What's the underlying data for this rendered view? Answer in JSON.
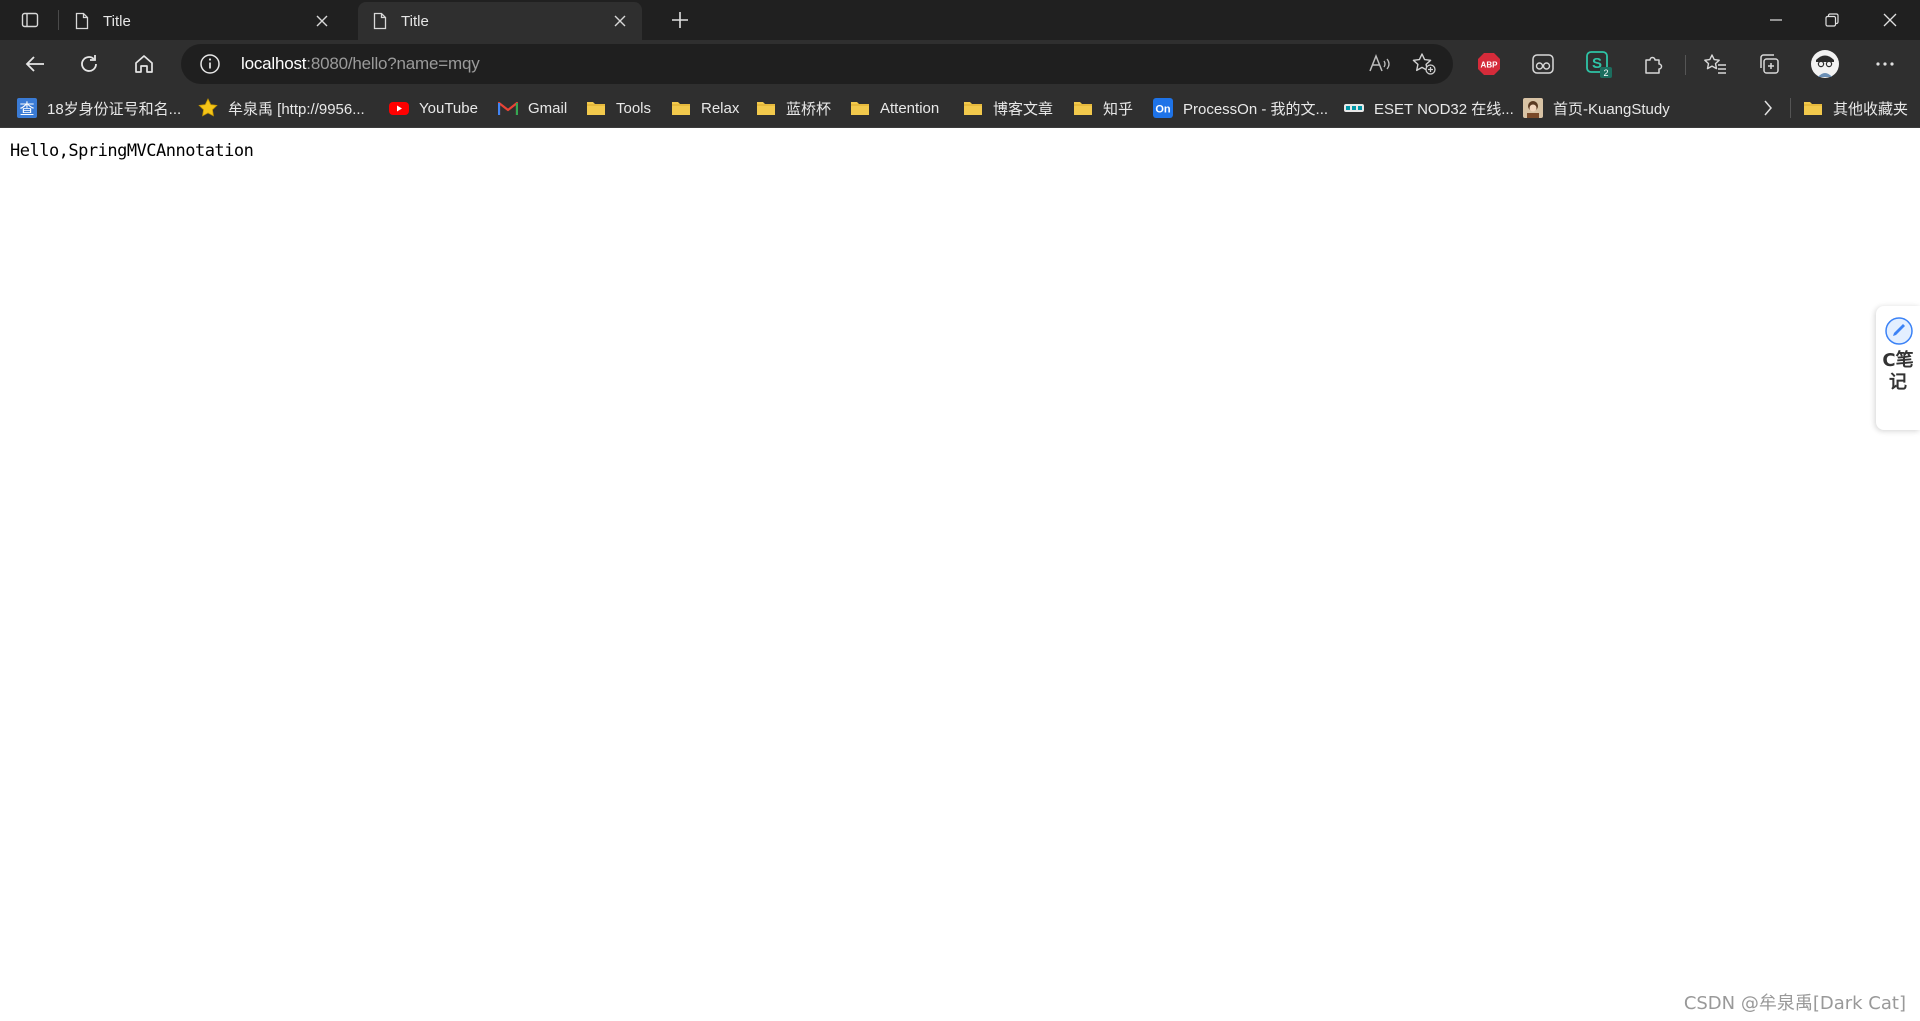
{
  "tabs": [
    {
      "title": "Title",
      "active": false
    },
    {
      "title": "Title",
      "active": true
    }
  ],
  "address_bar": {
    "host": "localhost",
    "path": ":8080/hello?name=mqy"
  },
  "bookmarks": [
    {
      "label": "18岁身份证号和名...",
      "icon": "cha-icon"
    },
    {
      "label": "牟泉禹 [http://9956...",
      "icon": "star-icon"
    },
    {
      "label": "YouTube",
      "icon": "youtube-icon"
    },
    {
      "label": "Gmail",
      "icon": "gmail-icon"
    },
    {
      "label": "Tools",
      "icon": "folder-icon"
    },
    {
      "label": "Relax",
      "icon": "folder-icon"
    },
    {
      "label": "蓝桥杯",
      "icon": "folder-icon"
    },
    {
      "label": "Attention",
      "icon": "folder-icon"
    },
    {
      "label": "博客文章",
      "icon": "folder-icon"
    },
    {
      "label": "知乎",
      "icon": "folder-icon"
    },
    {
      "label": "ProcessOn - 我的文...",
      "icon": "processon-icon"
    },
    {
      "label": "ESET NOD32 在线...",
      "icon": "eset-icon"
    },
    {
      "label": "首页-KuangStudy",
      "icon": "kuang-icon"
    }
  ],
  "other_bookmarks": "其他收藏夹",
  "extensions": {
    "abp": "ABP",
    "sbadge": "2"
  },
  "page": {
    "text": "Hello,SpringMVCAnnotation"
  },
  "side_widget": {
    "label": "C笔记"
  },
  "watermark": "CSDN @牟泉禹[Dark Cat]",
  "colors": {
    "tabstrip": "#202020",
    "toolbar": "#2f2f2f",
    "omnibox": "#1f1f1f",
    "folder": "#f2c94c",
    "abp_red": "#d52b3a",
    "youtube_red": "#ff0000"
  }
}
